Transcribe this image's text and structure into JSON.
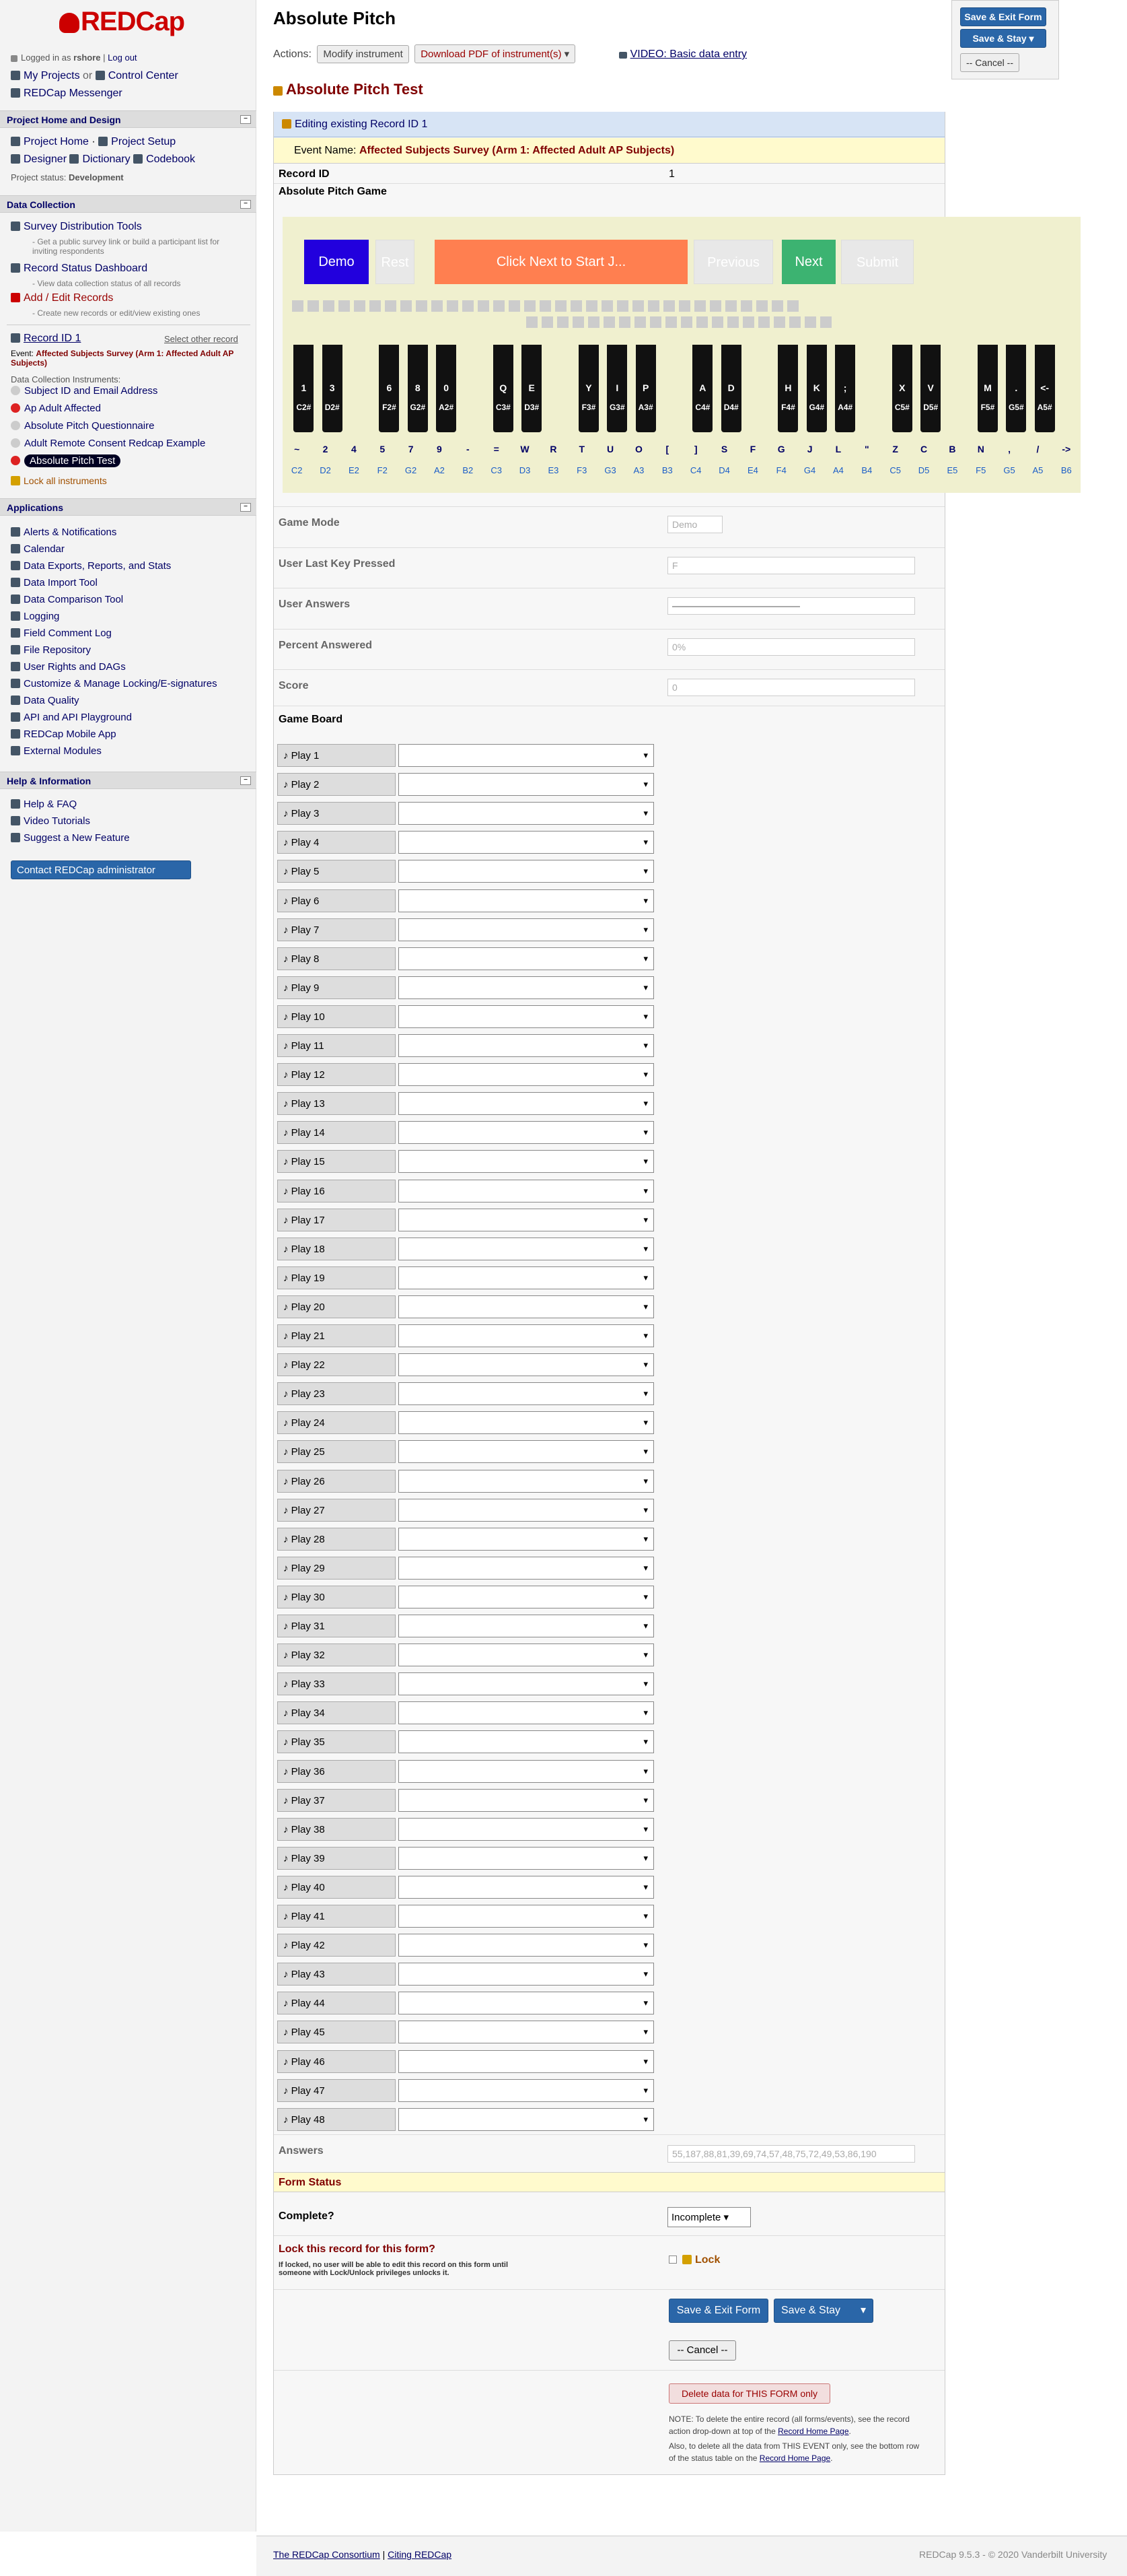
{
  "sidebar": {
    "logo": "REDCap",
    "logged_in_prefix": "Logged in as",
    "user": "rshore",
    "logout": "Log out",
    "my_projects": "My Projects",
    "or": "or",
    "control_center": "Control Center",
    "messenger": "REDCap Messenger",
    "sec_home": "Project Home and Design",
    "project_home": "Project Home",
    "project_setup": "Project Setup",
    "designer": "Designer",
    "dictionary": "Dictionary",
    "codebook": "Codebook",
    "status_label": "Project status:",
    "status_val": "Development",
    "sec_data": "Data Collection",
    "sdt": "Survey Distribution Tools",
    "sdt_desc": "- Get a public survey link or build a participant list for inviting respondents",
    "rsd": "Record Status Dashboard",
    "rsd_desc": "- View data collection status of all records",
    "add_edit": "Add / Edit Records",
    "add_edit_desc": "- Create new records or edit/view existing ones",
    "record": "Record ID 1",
    "select_other": "Select other record",
    "event_label": "Event:",
    "event_val": "Affected Subjects Survey (Arm 1: Affected Adult AP Subjects)",
    "instr_label": "Data Collection Instruments:",
    "instruments": [
      "Subject ID and Email Address",
      "Ap Adult Affected",
      "Absolute Pitch Questionnaire",
      "Adult Remote Consent Redcap Example",
      "Absolute Pitch Test"
    ],
    "lock_all": "Lock all instruments",
    "sec_apps": "Applications",
    "apps": [
      "Alerts & Notifications",
      "Calendar",
      "Data Exports, Reports, and Stats",
      "Data Import Tool",
      "Data Comparison Tool",
      "Logging",
      "Field Comment Log",
      "File Repository",
      "User Rights and DAGs",
      "Customize & Manage Locking/E-signatures",
      "Data Quality",
      "API and API Playground",
      "REDCap Mobile App",
      "External Modules"
    ],
    "sec_help": "Help & Information",
    "help": [
      "Help & FAQ",
      "Video Tutorials",
      "Suggest a New Feature"
    ],
    "contact": "Contact REDCap administrator"
  },
  "header": {
    "title": "Absolute Pitch",
    "actions": "Actions:",
    "modify": "Modify instrument",
    "download": "Download PDF of instrument(s)",
    "video": "VIDEO: Basic data entry",
    "save_exit": "Save & Exit Form",
    "save_stay": "Save & Stay",
    "cancel": "-- Cancel --"
  },
  "form": {
    "title": "Absolute Pitch Test",
    "editing": "Editing existing Record ID 1",
    "event_prefix": "Event Name:",
    "event": "Affected Subjects Survey (Arm 1: Affected Adult AP Subjects)",
    "record_id_label": "Record ID",
    "record_id": "1",
    "game_label": "Absolute Pitch Game",
    "game_btns": [
      "Demo",
      "Rest",
      "Click Next to Start J...",
      "Previous",
      "Next",
      "Submit"
    ],
    "black_keys": [
      [
        "1",
        "C2#"
      ],
      [
        "3",
        "D2#"
      ],
      [
        "6",
        "F2#"
      ],
      [
        "8",
        "G2#"
      ],
      [
        "0",
        "A2#"
      ],
      [
        "Q",
        "C3#"
      ],
      [
        "E",
        "D3#"
      ],
      [
        "Y",
        "F3#"
      ],
      [
        "I",
        "G3#"
      ],
      [
        "P",
        "A3#"
      ],
      [
        "A",
        "C4#"
      ],
      [
        "D",
        "D4#"
      ],
      [
        "H",
        "F4#"
      ],
      [
        "K",
        "G4#"
      ],
      [
        ";",
        "A4#"
      ],
      [
        "X",
        "C5#"
      ],
      [
        "V",
        "D5#"
      ],
      [
        "M",
        "F5#"
      ],
      [
        ".",
        "G5#"
      ],
      [
        "<-",
        "A5#"
      ]
    ],
    "white_keys": [
      [
        "~",
        "C2"
      ],
      [
        "2",
        "D2"
      ],
      [
        "4",
        "E2"
      ],
      [
        "5",
        "F2"
      ],
      [
        "7",
        "G2"
      ],
      [
        "9",
        "A2"
      ],
      [
        "-",
        "B2"
      ],
      [
        "=",
        "C3"
      ],
      [
        "W",
        "D3"
      ],
      [
        "R",
        "E3"
      ],
      [
        "T",
        "F3"
      ],
      [
        "U",
        "G3"
      ],
      [
        "O",
        "A3"
      ],
      [
        "[",
        "B3"
      ],
      [
        "]",
        "C4"
      ],
      [
        "S",
        "D4"
      ],
      [
        "F",
        "E4"
      ],
      [
        "G",
        "F4"
      ],
      [
        "J",
        "G4"
      ],
      [
        "L",
        "A4"
      ],
      [
        "\"",
        "B4"
      ],
      [
        "Z",
        "C5"
      ],
      [
        "C",
        "D5"
      ],
      [
        "B",
        "E5"
      ],
      [
        "N",
        "F5"
      ],
      [
        ",",
        "G5"
      ],
      [
        "/",
        "A5"
      ],
      [
        "->",
        "B6"
      ]
    ],
    "game_mode": "Game Mode",
    "game_mode_val": "Demo",
    "last_key": "User Last Key Pressed",
    "last_key_val": "F",
    "answers": "User Answers",
    "pct": "Percent Answered",
    "pct_val": "0%",
    "score": "Score",
    "score_val": "0",
    "board": "Game Board",
    "plays": [
      "Play 1",
      "Play 2",
      "Play 3",
      "Play 4",
      "Play 5",
      "Play 6",
      "Play 7",
      "Play 8",
      "Play 9",
      "Play 10",
      "Play 11",
      "Play 12",
      "Play 13",
      "Play 14",
      "Play 15",
      "Play 16",
      "Play 17",
      "Play 18",
      "Play 19",
      "Play 20",
      "Play 21",
      "Play 22",
      "Play 23",
      "Play 24",
      "Play 25",
      "Play 26",
      "Play 27",
      "Play 28",
      "Play 29",
      "Play 30",
      "Play 31",
      "Play 32",
      "Play 33",
      "Play 34",
      "Play 35",
      "Play 36",
      "Play 37",
      "Play 38",
      "Play 39",
      "Play 40",
      "Play 41",
      "Play 42",
      "Play 43",
      "Play 44",
      "Play 45",
      "Play 46",
      "Play 47",
      "Play 48"
    ],
    "answers_label": "Answers",
    "answers_val": "55,187,88,81,39,69,74,57,48,75,72,49,53,86,190",
    "status": "Form Status",
    "complete": "Complete?",
    "complete_val": "Incomplete",
    "lock_title": "Lock this record for this form?",
    "lock_desc": "If locked, no user will be able to edit this record on this form until someone with Lock/Unlock privileges unlocks it.",
    "lock": "Lock",
    "delete": "Delete data for THIS FORM only",
    "note1": "NOTE: To delete the entire record (all forms/events), see the record action drop-down at top of the",
    "note1_link": "Record Home Page",
    "note2": "Also, to delete all the data from THIS EVENT only, see the bottom row of the status table on the",
    "note2_link": "Record Home Page"
  },
  "footer": {
    "consortium": "The REDCap Consortium",
    "citing": "Citing REDCap",
    "version": "REDCap 9.5.3 - © 2020 Vanderbilt University"
  }
}
